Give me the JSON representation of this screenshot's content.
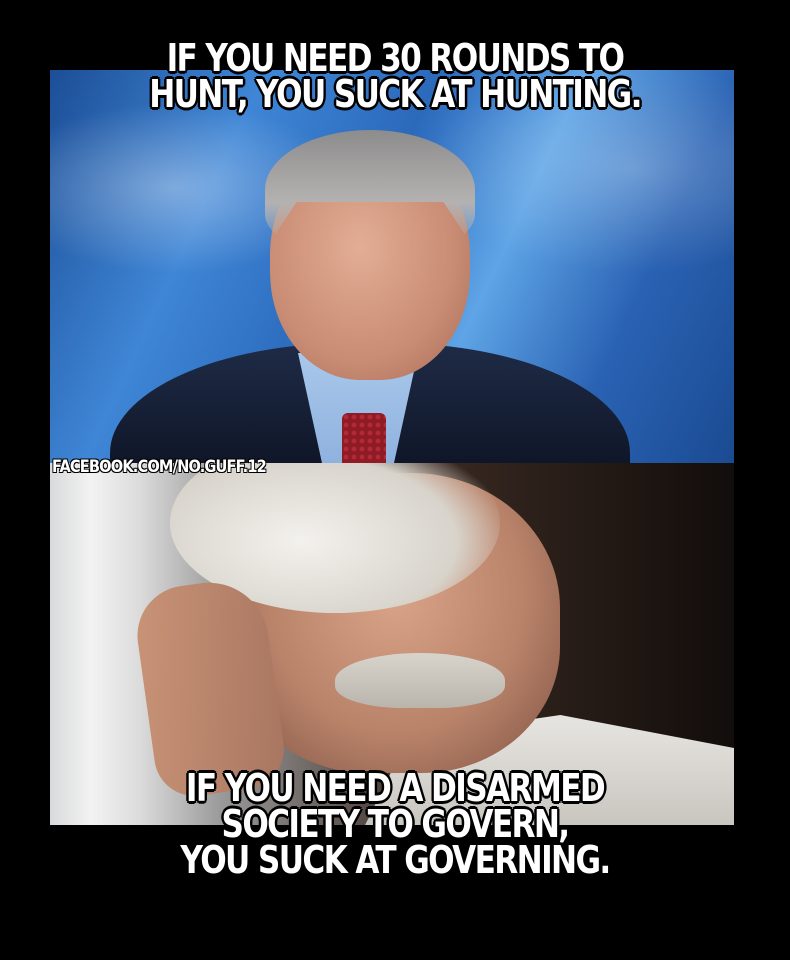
{
  "meme": {
    "top_caption": [
      "IF YOU NEED 30 ROUNDS TO",
      "HUNT, YOU SUCK AT HUNTING."
    ],
    "watermark": "FACEBOOK.COM/NO.GUFF.12",
    "bottom_caption": [
      "IF YOU NEED A DISARMED",
      "SOCIETY TO GOVERN,",
      "YOU SUCK AT GOVERNING."
    ]
  },
  "colors": {
    "background": "#000000",
    "text": "#ffffff",
    "text_outline": "#000000",
    "top_backdrop": "#3f86d6"
  }
}
